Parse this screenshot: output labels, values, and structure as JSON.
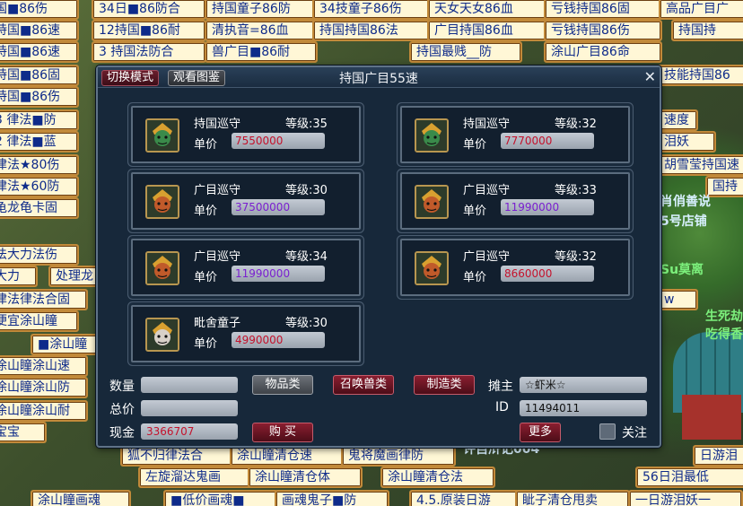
{
  "background_tags": [
    "国■86伤",
    "34日■86防合",
    "持国童子86防",
    "34技童子86伤",
    "天女天女86血",
    "亏钱持国86固",
    "高品广目广",
    "持国■86速",
    "12持国■86耐",
    "清执音=86血",
    "持国持国86法",
    "广目持国86血",
    "亏钱持国86伤",
    "持国持",
    "持国■86速",
    "3 持国法防合",
    "兽广目■86耐",
    "持国最贱__防",
    "涂山广目86命",
    "持国■86固",
    "持国■86伤",
    "3 律法■防",
    "2 律法■蓝",
    "律法★80伤",
    "律法★60防",
    "龟龙龟卡固",
    "法大力法伤",
    "大力",
    "处理龙",
    "律法律法合固",
    "便宜涂山瞳",
    "■涂山瞳",
    "涂山瞳涂山速",
    "涂山瞳涂山防",
    "涂山瞳涂山耐",
    "宝宝",
    "狐不归律法合",
    "涂山瞳清仓速",
    "鬼将魔画律防",
    "左旋溜达鬼画",
    "涂山瞳清仓体",
    "涂山瞳清仓法",
    "56日泪最低",
    "涂山瞳画魂",
    "■低价画魂■",
    "画魂鬼子■防",
    "4.5.原装日游",
    "眦子清仓甩卖",
    "一日游泪妖一",
    "技能持国86",
    "速度",
    "泪妖",
    "胡雪莹持国速",
    "国持",
    "w",
    "日游泪"
  ],
  "background_floating": [
    "肖俏善说",
    "5号店铺",
    "Su莫离",
    "生死劫",
    "吃得香",
    "许自浒记004"
  ],
  "dialog": {
    "tab_switch": "切换模式",
    "tab_view": "观看图鉴",
    "title": "持国广目55速",
    "close": "✕"
  },
  "level_prefix": "等级:",
  "price_label": "单价",
  "items": [
    {
      "name": "持国巡守",
      "level": "35",
      "price": "7550000",
      "price_color": "#c4122c"
    },
    {
      "name": "持国巡守",
      "level": "32",
      "price": "7770000",
      "price_color": "#c4122c"
    },
    {
      "name": "广目巡守",
      "level": "30",
      "price": "37500000",
      "price_color": "#7a1fd0"
    },
    {
      "name": "广目巡守",
      "level": "33",
      "price": "11990000",
      "price_color": "#7a1fd0"
    },
    {
      "name": "广目巡守",
      "level": "34",
      "price": "11990000",
      "price_color": "#7a1fd0"
    },
    {
      "name": "广目巡守",
      "level": "32",
      "price": "8660000",
      "price_color": "#c4122c"
    },
    {
      "name": "毗舍童子",
      "level": "30",
      "price": "4990000",
      "price_color": "#c4122c"
    }
  ],
  "footer": {
    "qty_label": "数量",
    "qty_value": "",
    "total_label": "总价",
    "total_value": "",
    "cash_label": "现金",
    "cash_value": "3366707",
    "btn_items": "物品类",
    "btn_summon": "召唤兽类",
    "btn_craft": "制造类",
    "btn_buy": "购 买",
    "owner_label": "摊主",
    "owner_value": "☆虾米☆",
    "id_label": "ID",
    "id_value": "11494011",
    "btn_more": "更多",
    "follow_label": "关注"
  }
}
